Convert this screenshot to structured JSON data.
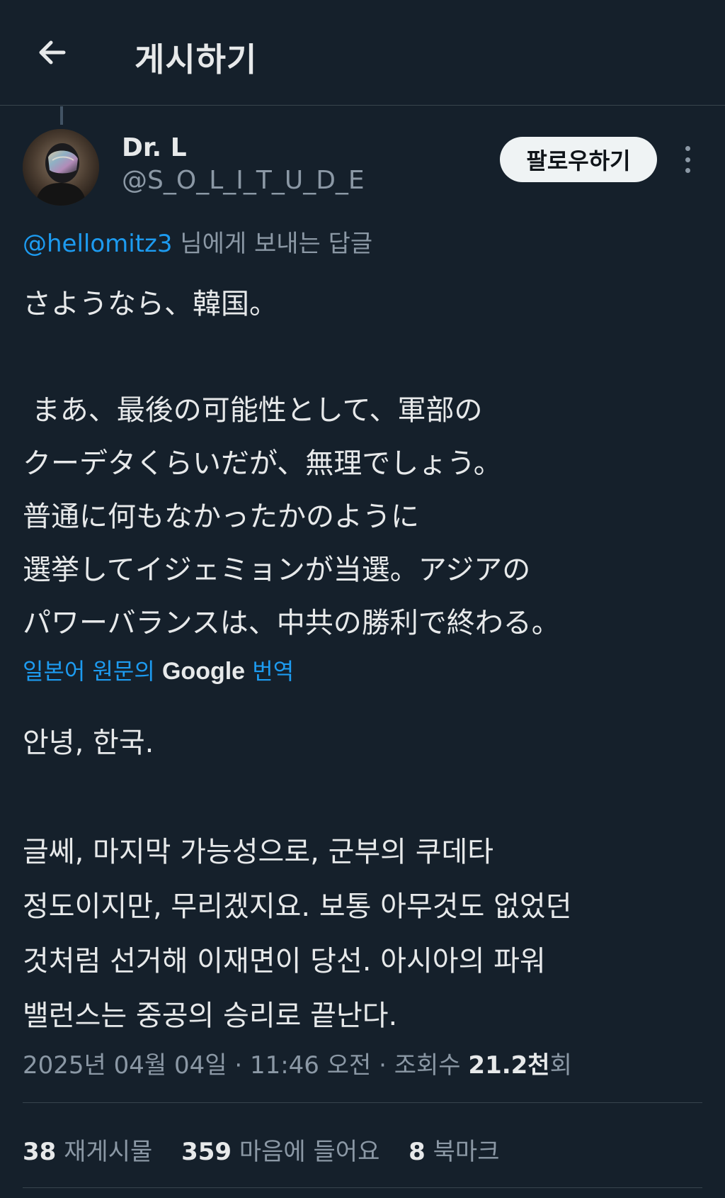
{
  "header": {
    "title": "게시하기",
    "back_icon": "arrow-left-icon"
  },
  "author": {
    "display_name": "Dr. L",
    "handle": "@S_O_L_I_T_U_D_E",
    "avatar_icon": "avatar-helmet"
  },
  "follow_button": {
    "label": "팔로우하기"
  },
  "more_button": {
    "icon": "more-vertical-icon"
  },
  "reply": {
    "mention": "@hellomitz3",
    "suffix": " 님에게 보내는 답글"
  },
  "tweet": {
    "lines": [
      "さようなら、韓国。",
      "",
      " まあ、最後の可能性として、軍部の",
      "クーデタくらいだが、無理でしょう。",
      "普通に何もなかったかのように",
      "選挙してイジェミョンが当選。アジアの",
      "パワーバランスは、中共の勝利で終わる。"
    ]
  },
  "translation": {
    "prefix": "일본어 원문의 ",
    "brand": "Google",
    "suffix": " 번역",
    "lines": [
      "안녕, 한국.",
      "",
      "글쎄, 마지막 가능성으로, 군부의 쿠데타",
      "정도이지만, 무리겠지요. 보통 아무것도 없었던",
      "것처럼 선거해 이재면이 당선. 아시아의 파워",
      "밸런스는 중공의 승리로 끝난다."
    ]
  },
  "meta": {
    "date": "2025년 04월 04일",
    "separator": " · ",
    "time": "11:46 오전",
    "views_label": "조회수 ",
    "views_count": "21.2천",
    "views_suffix": "회"
  },
  "stats": {
    "reposts_count": "38",
    "reposts_label": " 재게시물",
    "likes_count": "359",
    "likes_label": " 마음에 들어요",
    "bookmarks_count": "8",
    "bookmarks_label": " 북마크"
  },
  "colors": {
    "background": "#15202b",
    "accent": "#1d9bf0",
    "text_primary": "#e7e9ea",
    "text_secondary": "#8b98a5"
  }
}
